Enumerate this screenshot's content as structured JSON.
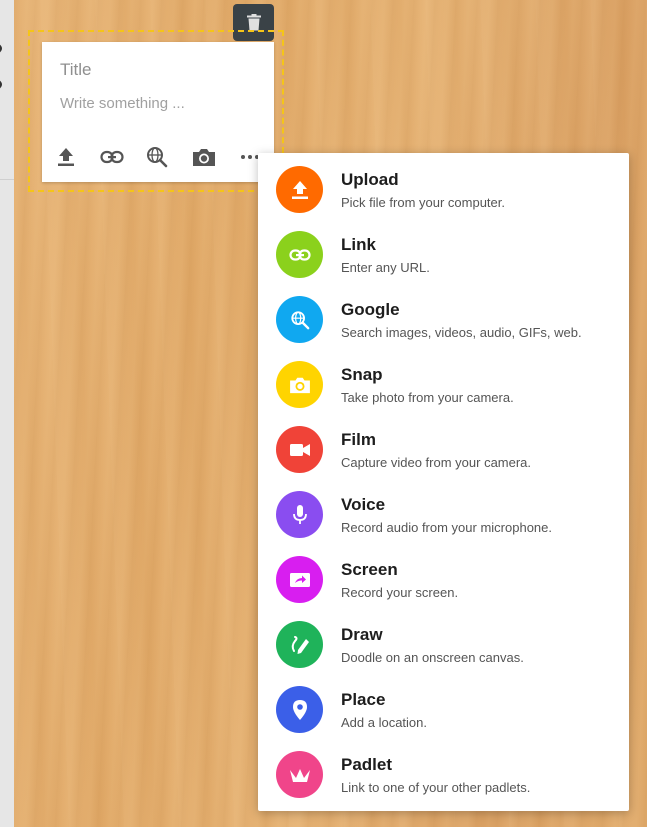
{
  "note": {
    "title_placeholder": "Title",
    "body_placeholder": "Write something ...",
    "tools": [
      "upload-icon",
      "link-icon",
      "search-globe-icon",
      "camera-icon",
      "more-icon"
    ]
  },
  "toolbar": {
    "delete_icon": "trash-icon"
  },
  "menu": {
    "items": [
      {
        "label": "Upload",
        "desc": "Pick file from your computer.",
        "color": "#ff6a00",
        "icon": "upload-icon"
      },
      {
        "label": "Link",
        "desc": "Enter any URL.",
        "color": "#8bd11c",
        "icon": "link-icon"
      },
      {
        "label": "Google",
        "desc": "Search images, videos, audio, GIFs, web.",
        "color": "#10a8f0",
        "icon": "search-globe-icon"
      },
      {
        "label": "Snap",
        "desc": "Take photo from your camera.",
        "color": "#ffd400",
        "icon": "camera-icon"
      },
      {
        "label": "Film",
        "desc": "Capture video from your camera.",
        "color": "#f04338",
        "icon": "video-camera-icon"
      },
      {
        "label": "Voice",
        "desc": "Record audio from your microphone.",
        "color": "#8a4df0",
        "icon": "microphone-icon"
      },
      {
        "label": "Screen",
        "desc": "Record your screen.",
        "color": "#d81ef0",
        "icon": "screen-record-icon"
      },
      {
        "label": "Draw",
        "desc": "Doodle on an onscreen canvas.",
        "color": "#1fb35a",
        "icon": "pen-icon"
      },
      {
        "label": "Place",
        "desc": "Add a location.",
        "color": "#3b5fe8",
        "icon": "location-pin-icon"
      },
      {
        "label": "Padlet",
        "desc": "Link to one of your other padlets.",
        "color": "#f0458a",
        "icon": "padlet-icon"
      }
    ]
  }
}
